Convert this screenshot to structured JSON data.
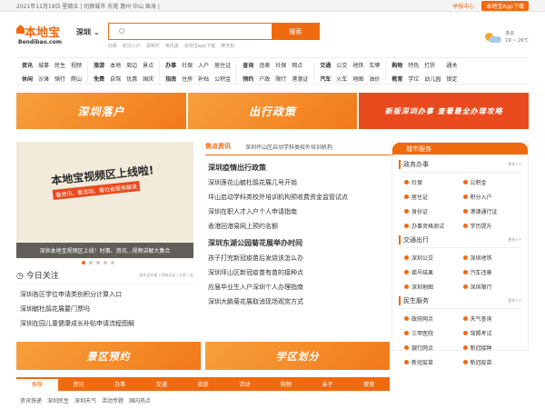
{
  "topbar": {
    "left_text": "2021年11月19日 星期五 | 切换城市 东莞 惠州 中山 珠海 |",
    "help": "举报中心",
    "app": "本地宝App下载"
  },
  "logo": {
    "cn": "本地宝",
    "en": "Bendibao.com"
  },
  "city": "深圳",
  "search": {
    "placeholder": "",
    "button": "搜索",
    "hot": [
      "社保",
      "积分入户",
      "清明节",
      "电讯嘉",
      "本地宝app下载",
      "摩天轮"
    ]
  },
  "weather": {
    "condition": "多云",
    "temp": "19 ~ 26℃"
  },
  "nav": [
    {
      "items": [
        {
          "t": "资讯",
          "b": true
        },
        {
          "t": "城事"
        },
        {
          "t": "民生"
        },
        {
          "t": "视频"
        },
        {
          "t": "休闲",
          "b": true
        },
        {
          "t": "沙滩"
        },
        {
          "t": "骑行"
        },
        {
          "t": "爬山"
        }
      ]
    },
    {
      "items": [
        {
          "t": "旅游",
          "b": true
        },
        {
          "t": "本地"
        },
        {
          "t": "周边"
        },
        {
          "t": "景点"
        },
        {
          "t": "免费",
          "b": true
        },
        {
          "t": "自驾"
        },
        {
          "t": "优惠"
        },
        {
          "t": "国庆"
        }
      ]
    },
    {
      "items": [
        {
          "t": "办事",
          "b": true
        },
        {
          "t": "社保"
        },
        {
          "t": "入户"
        },
        {
          "t": "居住证"
        },
        {
          "t": "指南",
          "b": true
        },
        {
          "t": "住房"
        },
        {
          "t": "补贴"
        },
        {
          "t": "公积金"
        }
      ]
    },
    {
      "items": [
        {
          "t": "查询",
          "b": true
        },
        {
          "t": "违章"
        },
        {
          "t": "社保"
        },
        {
          "t": "网点"
        },
        {
          "t": "预约",
          "b": true
        },
        {
          "t": "户政"
        },
        {
          "t": "限行"
        },
        {
          "t": "港澳证"
        }
      ]
    },
    {
      "items": [
        {
          "t": "交通",
          "b": true
        },
        {
          "t": "公交"
        },
        {
          "t": "地铁"
        },
        {
          "t": "车牌"
        },
        {
          "t": "汽车",
          "b": true
        },
        {
          "t": "火车"
        },
        {
          "t": "地图"
        },
        {
          "t": "油价"
        }
      ]
    },
    {
      "items": [
        {
          "t": "购物",
          "b": true
        },
        {
          "t": "特色"
        },
        {
          "t": "打折"
        },
        {
          "t": "通关"
        },
        {
          "t": "教育",
          "b": true
        },
        {
          "t": "学位"
        },
        {
          "t": "幼儿园"
        },
        {
          "t": "锁定"
        }
      ]
    }
  ],
  "banners": [
    "深圳落户",
    "出行政策",
    "新版深圳办事 查看最全办理攻略"
  ],
  "slider": {
    "title": "本地宝视频区上线啦!",
    "subtitle": "看资讯、看活动、看社会服务解读",
    "caption": "深圳本地宝视频区上线！时事、资讯...视频讲解大集合"
  },
  "today": {
    "title": "今日关注",
    "links": "居住证办理 | 同城活动 | 五险一金",
    "items": [
      "深圳各区学位申请类别积分计算入口",
      "深圳毓杜鹃花展要门票吗",
      "深圳在园儿童健康成长补贴申请流程图解"
    ]
  },
  "news": {
    "tab": "焦点资讯",
    "tab2": "深圳坪山区启动学科类校外培训机构",
    "h1": "深圳疫情出行政策",
    "items1": [
      "深圳莲花山毓杜鹃花展几号开始",
      "坪山启动学科类校外培训机构预收费资金监管试点",
      "深圳在职人才入户个人申请指南",
      "香港回港易网上预约名额"
    ],
    "h2": "深圳东湖公园菊花展举办时间",
    "items2": [
      "孩子打完新冠疫苗后发烧该怎么办",
      "深圳坪山区新冠疫苗有苗的接种点",
      "应届毕业生入户深圳个人办理指南",
      "深圳大鹏菊花展取消现场观赏方式"
    ]
  },
  "service": {
    "title": "城市服务",
    "sections": [
      {
        "name": "政务办事",
        "more": "更多>>",
        "items": [
          "社保",
          "公积金",
          "居住证",
          "积分入户",
          "身份证",
          "港澳通行证",
          "办事资格测试",
          "学历提升"
        ]
      },
      {
        "name": "交通出行",
        "more": "更多>>",
        "items": [
          "深圳公交",
          "深圳地铁",
          "摇号结果",
          "汽车违章",
          "深圳地图",
          "深圳限行"
        ]
      },
      {
        "name": "民生服务",
        "more": "更多>>",
        "items": [
          "政府网点",
          "天气查询",
          "三甲医院",
          "驾照考试",
          "银行网点",
          "新冠接种",
          "新冠疫苗",
          "新冠疫苗"
        ]
      }
    ]
  },
  "lower_banners": [
    "景区预约",
    "学区划分"
  ],
  "tabs": [
    "推荐",
    "资讯",
    "办事",
    "交通",
    "旅游",
    "活动",
    "购物",
    "亲子",
    "教育"
  ],
  "subtabs": [
    "资讯快递",
    "深圳民生",
    "深圳天气",
    "活动专题",
    "国内热点"
  ],
  "colors": {
    "accent": "#f06a0f"
  }
}
